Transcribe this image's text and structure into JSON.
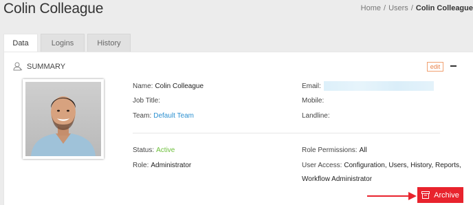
{
  "header": {
    "title": "Colin Colleague",
    "breadcrumb": [
      "Home",
      "Users",
      "Colin Colleague"
    ]
  },
  "tabs": [
    {
      "label": "Data",
      "active": true
    },
    {
      "label": "Logins",
      "active": false
    },
    {
      "label": "History",
      "active": false
    }
  ],
  "summary": {
    "heading": "SUMMARY",
    "icon": "user-icon",
    "edit_label": "edit"
  },
  "details": {
    "name_label": "Name:",
    "name_value": "Colin Colleague",
    "job_title_label": "Job Title:",
    "job_title_value": "",
    "team_label": "Team:",
    "team_value": "Default Team",
    "email_label": "Email:",
    "mobile_label": "Mobile:",
    "landline_label": "Landline:",
    "status_label": "Status:",
    "status_value": "Active",
    "role_label": "Role:",
    "role_value": "Administrator",
    "role_permissions_label": "Role Permissions:",
    "role_permissions_value": "All",
    "user_access_label": "User Access:",
    "user_access_value": "Configuration, Users, History, Reports,",
    "user_access_value_cont": "Workflow Administrator"
  },
  "actions": {
    "archive_label": "Archive"
  },
  "colors": {
    "accent_red": "#e8232d",
    "link_blue": "#2a8fd0",
    "active_green": "#6cbf3a",
    "edit_orange": "#e8834a"
  }
}
